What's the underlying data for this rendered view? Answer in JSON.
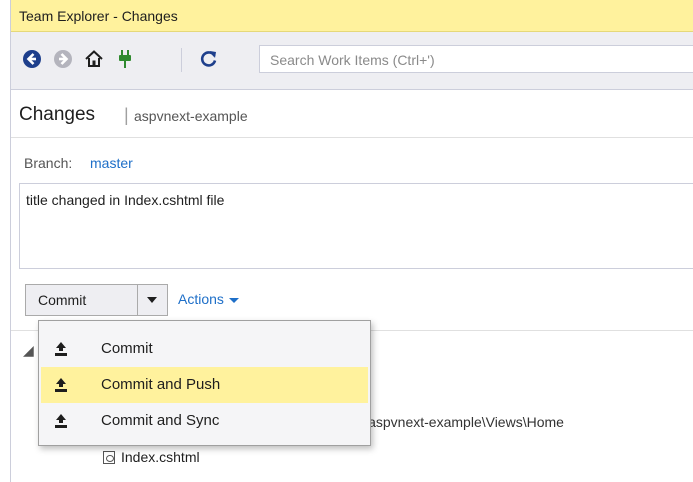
{
  "window": {
    "title": "Team Explorer - Changes"
  },
  "toolbar": {
    "search_placeholder": "Search Work Items (Ctrl+')",
    "icons": [
      "back-icon",
      "forward-icon",
      "home-icon",
      "connect-icon",
      "refresh-icon"
    ]
  },
  "header": {
    "title": "Changes",
    "separator": "|",
    "repo": "aspvnext-example"
  },
  "branch": {
    "label": "Branch:",
    "value": "master"
  },
  "commit_message": "title changed in Index.cshtml file",
  "commit_button": {
    "label": "Commit"
  },
  "actions": {
    "label": "Actions"
  },
  "dropdown_menu": {
    "items": [
      {
        "label": "Commit",
        "icon": "upload-icon",
        "highlighted": false
      },
      {
        "label": "Commit and Push",
        "icon": "upload-icon",
        "highlighted": true
      },
      {
        "label": "Commit and Sync",
        "icon": "upload-icon",
        "highlighted": false
      }
    ]
  },
  "changes": {
    "path": "\\jjj\\aspvnext-example\\Views\\Home",
    "file": "Index.cshtml"
  },
  "colors": {
    "title_bar": "#fff29d",
    "accent": "#1e6fc8",
    "highlight": "#fff29d"
  }
}
